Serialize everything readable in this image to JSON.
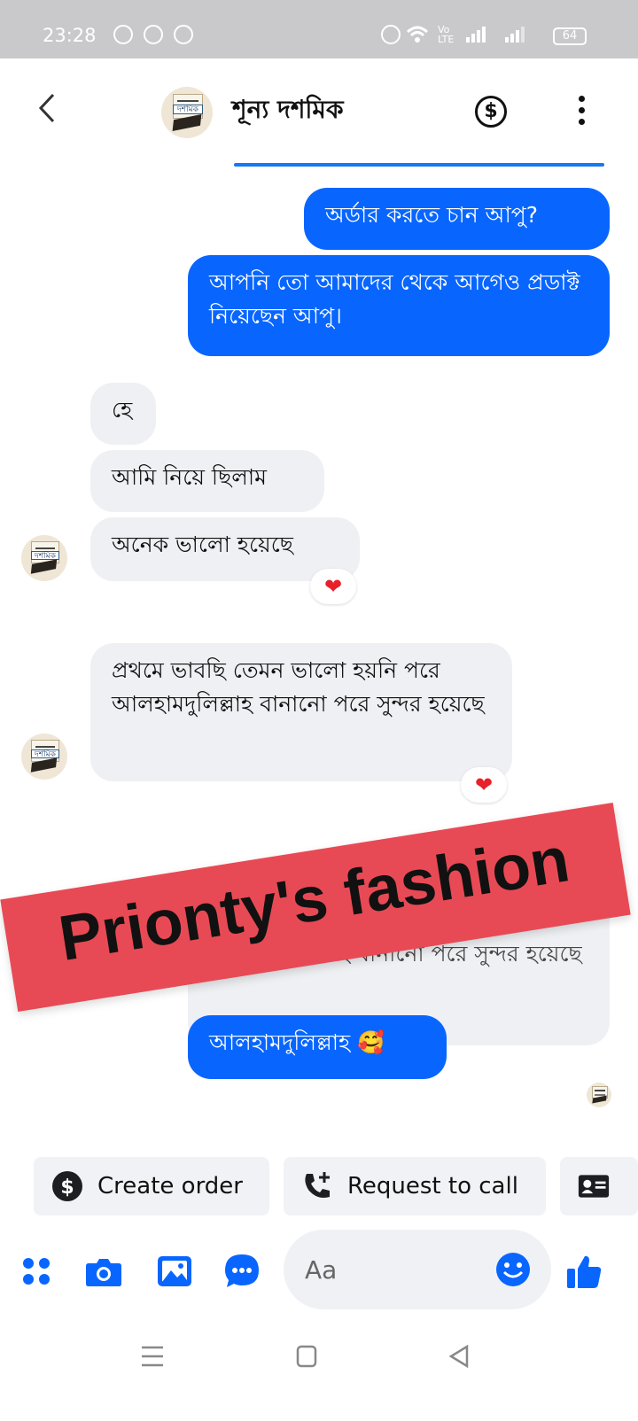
{
  "status_bar": {
    "time": "23:28",
    "network_label": "Vo LTE",
    "battery": "64"
  },
  "header": {
    "back_icon": "chevron-left-icon",
    "contact_name": "শূন্য দশমিক",
    "avatar_text": "দশমিক",
    "payment_icon": "dollar-circle-icon",
    "menu_icon": "more-vertical-icon"
  },
  "messages": [
    {
      "side": "sent",
      "text": "অর্ডার করতে চান আপু?"
    },
    {
      "side": "sent",
      "text": "আপনি তো আমাদের থেকে আগেও প্রডাক্ট নিয়েছেন আপু।"
    },
    {
      "side": "received",
      "text": "হে"
    },
    {
      "side": "received",
      "text": "আমি নিয়ে ছিলাম"
    },
    {
      "side": "received",
      "text": "অনেক ভালো  হয়েছে",
      "reaction": "❤"
    },
    {
      "side": "received",
      "text": "প্রথমে ভাবছি তেমন ভালো  হয়নি পরে আলহামদুলিল্লাহ  বানানো পরে সুন্দর  হয়েছে",
      "reaction": "❤"
    },
    {
      "side": "sent",
      "text": "প্রথমে ভাবছি তেমন ভালো  হয়নি পরে আলহামদুলিল্লাহ  বানানো পরে সুন্দর  হয়েছে",
      "is_reply_preview": true
    },
    {
      "side": "sent",
      "text": "আলহামদুলিল্লাহ 🥰"
    }
  ],
  "watermark": "Prionty's fashion",
  "quick_actions": [
    {
      "label": "Create order",
      "icon": "dollar-circle-icon"
    },
    {
      "label": "Request to call",
      "icon": "phone-plus-icon"
    },
    {
      "label": "",
      "icon": "contact-card-icon"
    }
  ],
  "composer": {
    "placeholder": "Aa",
    "icons": [
      "apps-icon",
      "camera-icon",
      "gallery-icon",
      "chat-bubble-icon",
      "emoji-icon",
      "thumbs-up-icon"
    ]
  },
  "nav_bar": {
    "icons": [
      "menu-icon",
      "home-icon",
      "back-icon"
    ]
  },
  "colors": {
    "accent": "#0866ff",
    "received_bubble": "#eef0f3",
    "watermark_bg": "#e84a55",
    "status_bar": "#c9c9cc"
  }
}
